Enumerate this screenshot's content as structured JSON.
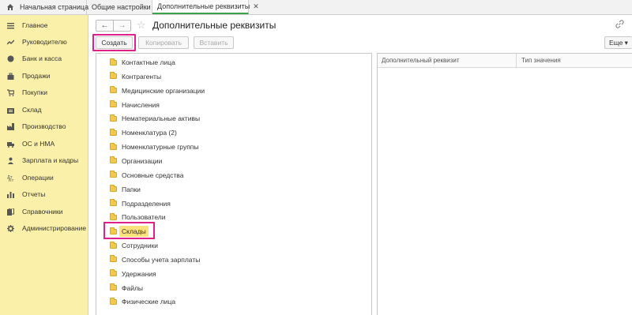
{
  "tabs": [
    {
      "label": "Начальная страница",
      "closable": false
    },
    {
      "label": "Общие настройки",
      "closable": true
    },
    {
      "label": "Дополнительные реквизиты",
      "closable": true,
      "active": true
    }
  ],
  "tab_close_glyph": "✕",
  "sidebar": {
    "items": [
      {
        "label": "Главное",
        "icon": "list-icon"
      },
      {
        "label": "Руководителю",
        "icon": "trend-icon"
      },
      {
        "label": "Банк и касса",
        "icon": "coin-icon"
      },
      {
        "label": "Продажи",
        "icon": "bag-icon"
      },
      {
        "label": "Покупки",
        "icon": "cart-icon"
      },
      {
        "label": "Склад",
        "icon": "warehouse-icon"
      },
      {
        "label": "Производство",
        "icon": "factory-icon"
      },
      {
        "label": "ОС и НМА",
        "icon": "truck-icon"
      },
      {
        "label": "Зарплата и кадры",
        "icon": "person-icon"
      },
      {
        "label": "Операции",
        "icon": "operations-icon"
      },
      {
        "label": "Отчеты",
        "icon": "bar-chart-icon"
      },
      {
        "label": "Справочники",
        "icon": "books-icon"
      },
      {
        "label": "Администрирование",
        "icon": "gear-icon"
      }
    ]
  },
  "header": {
    "back": "←",
    "forward": "→",
    "star": "☆",
    "title": "Дополнительные реквизиты",
    "link": "🔗"
  },
  "toolbar": {
    "create": "Создать",
    "copy": "Копировать",
    "paste": "Вставить",
    "more": "Еще ▾"
  },
  "folders": [
    "Контактные лица",
    "Контрагенты",
    "Медицинские организации",
    "Начисления",
    "Нематериальные активы",
    "Номенклатура (2)",
    "Номенклатурные группы",
    "Организации",
    "Основные средства",
    "Папки",
    "Подразделения",
    "Пользователи",
    "Склады",
    "Сотрудники",
    "Способы учета зарплаты",
    "Удержания",
    "Файлы",
    "Физические лица"
  ],
  "selected_folder": "Склады",
  "table": {
    "columns": [
      "Дополнительный реквизит",
      "Тип значения"
    ]
  },
  "colors": {
    "sidebar_bg": "#fbf0a9",
    "highlight": "#e0208c",
    "selected_bg": "#fce27d",
    "folder": "#f2c94c",
    "active_tab_accent": "#3aa34a"
  }
}
